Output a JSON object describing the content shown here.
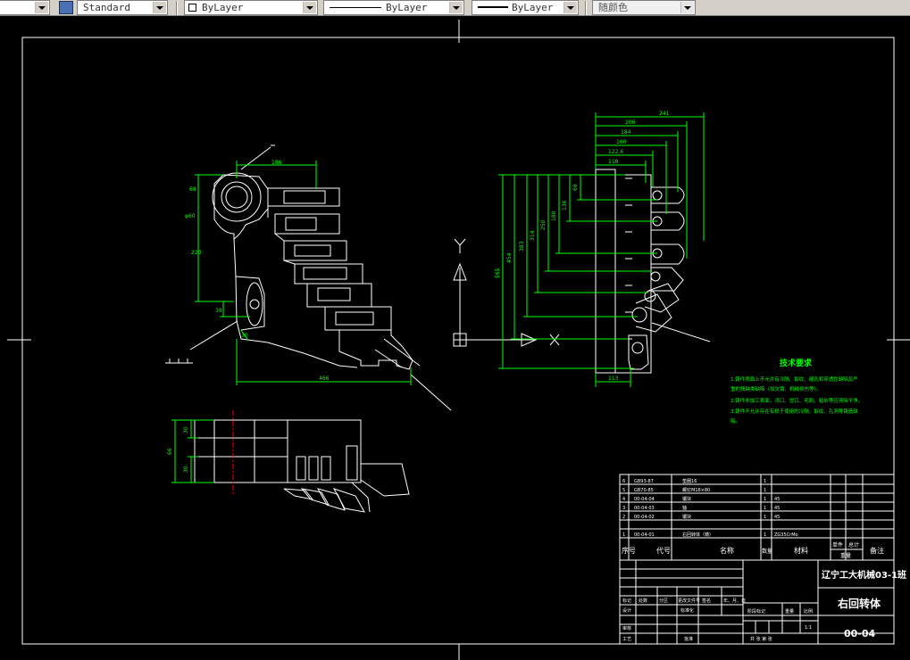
{
  "toolbar": {
    "text_style": "Standard",
    "layer": "ByLayer",
    "linetype": "ByLayer",
    "lineweight": "ByLayer",
    "plot_style": "随颜色"
  },
  "drawing": {
    "axis_y": "Y",
    "axis_x": "X",
    "dims_front": {
      "top": "186",
      "left_a": "68",
      "left_b": "φ60",
      "left_c": "220",
      "left_d": "38",
      "left_e": "30",
      "bottom": "466"
    },
    "dims_side": {
      "d1": "241",
      "d2": "206",
      "d3": "184",
      "d4": "160",
      "d5": "122.6",
      "d6": "118",
      "bottom": "113",
      "v1": "565",
      "v2": "454",
      "v3": "383",
      "v4": "314",
      "v5": "250",
      "v6": "180",
      "v7": "136",
      "v8": "68"
    },
    "dims_top": {
      "a": "66",
      "b": "30",
      "c": "30"
    }
  },
  "tech_req": {
    "title": "技术要求",
    "lines": [
      "1.铸件表面上不允许有冷隔、裂纹、缩孔和穿透性缺陷及严",
      "重的残缺类缺陷（如欠铸、机械损伤等）。",
      "2.铸件非加工表面，浇口、冒口、毛刺、粘砂等应清除干净。",
      "3.铸件不允许存在有损于使用的冷隔、裂纹、孔洞等铸造缺",
      "陷。"
    ]
  },
  "parts_list": {
    "rows": [
      {
        "no": "6",
        "code": "GB93-87",
        "name": "垫圈16",
        "qty": "1",
        "mat": ""
      },
      {
        "no": "5",
        "code": "GB70-85",
        "name": "螺钉M16×80",
        "qty": "1",
        "mat": ""
      },
      {
        "no": "4",
        "code": "00-04-04",
        "name": "镶块",
        "qty": "1",
        "mat": "45"
      },
      {
        "no": "3",
        "code": "00-04-03",
        "name": "轴",
        "qty": "1",
        "mat": "45"
      },
      {
        "no": "2",
        "code": "00-04-02",
        "name": "镶块",
        "qty": "1",
        "mat": "45"
      },
      {
        "no": "1",
        "code": "00-04-01",
        "name": "右回转体（铸）",
        "qty": "1",
        "mat": "ZG35CrMo"
      }
    ],
    "header": {
      "no": "序号",
      "code": "代号",
      "name": "名称",
      "qty": "数量",
      "mat": "材料",
      "unit_w": "单件",
      "total_w": "总计",
      "weight": "重量",
      "note": "备注"
    }
  },
  "title_block": {
    "school": "辽宁工大机械03-1班",
    "part_name": "右回转体",
    "drawing_no": "00-04",
    "rev_headers": [
      "标记",
      "处数",
      "分区",
      "更改文件号",
      "签名",
      "年、月、日"
    ],
    "design": "设计",
    "standardize": "标准化",
    "check": "审核",
    "process": "工艺",
    "approve": "批准",
    "stage": "阶段标记",
    "weight": "重量",
    "scale": "比例",
    "scale_val": "1:1",
    "sheets": "共  张  第  张"
  }
}
